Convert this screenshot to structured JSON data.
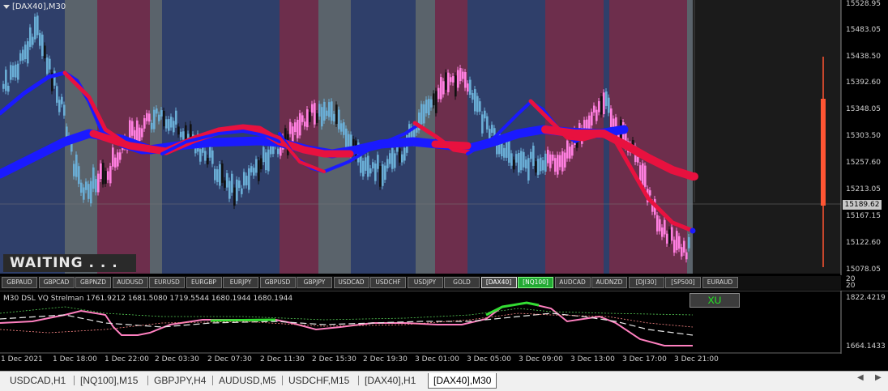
{
  "chart": {
    "title": "[DAX40],M30",
    "waiting_text": "WAITING . . .",
    "current_price": "15189.62",
    "price_axis": [
      "15528.95",
      "15483.05",
      "15438.50",
      "15392.60",
      "15348.05",
      "15303.50",
      "15257.60",
      "15213.05",
      "15167.15",
      "15122.60",
      "15078.05"
    ],
    "colors": {
      "bg_blue": "#2f3f6a",
      "bg_red": "#6d2e4c",
      "bg_grey": "#5a636b",
      "bull_candle": "#6aaed6",
      "bear_candle": "#ff7fe0",
      "ma_fast": "#e8113f",
      "ma_slow": "#1a1aff",
      "signal_bar": "#ff5533"
    }
  },
  "symbol_bar": {
    "buttons": [
      "GBPAUD",
      "GBPCAD",
      "GBPNZD",
      "AUDUSD",
      "EURUSD",
      "EURGBP",
      "EURJPY",
      "GBPUSD",
      "GBPJPY",
      "USDCAD",
      "USDCHF",
      "USDJPY",
      "GOLD",
      "[DAX40]",
      "[NQ100]",
      "AUDCAD",
      "AUDNZD",
      "[DJI30]",
      "[SP500]",
      "EURAUD"
    ],
    "active": "[DAX40]",
    "green": "[NQ100]",
    "axis_top": "20",
    "axis_bottom": "20"
  },
  "indicator": {
    "title": "M30 DSL VQ Strelman 1761.9212 1681.5080 1719.5544 1680.1944 1680.1944",
    "button_label": "XU",
    "axis_top": "1822.4219",
    "axis_bottom": "1664.1433"
  },
  "time_axis": [
    "1 Dec 2021",
    "1 Dec 18:00",
    "1 Dec 22:00",
    "2 Dec 03:30",
    "2 Dec 07:30",
    "2 Dec 11:30",
    "2 Dec 15:30",
    "2 Dec 19:30",
    "3 Dec 01:00",
    "3 Dec 05:00",
    "3 Dec 09:00",
    "3 Dec 13:00",
    "3 Dec 17:00",
    "3 Dec 21:00"
  ],
  "tabs": [
    "USDCAD,H1",
    "[NQ100],M15",
    "GBPJPY,H4",
    "AUDUSD,M5",
    "USDCHF,M15",
    "[DAX40],H1",
    "[DAX40],M30"
  ],
  "active_tab": "[DAX40],M30"
}
